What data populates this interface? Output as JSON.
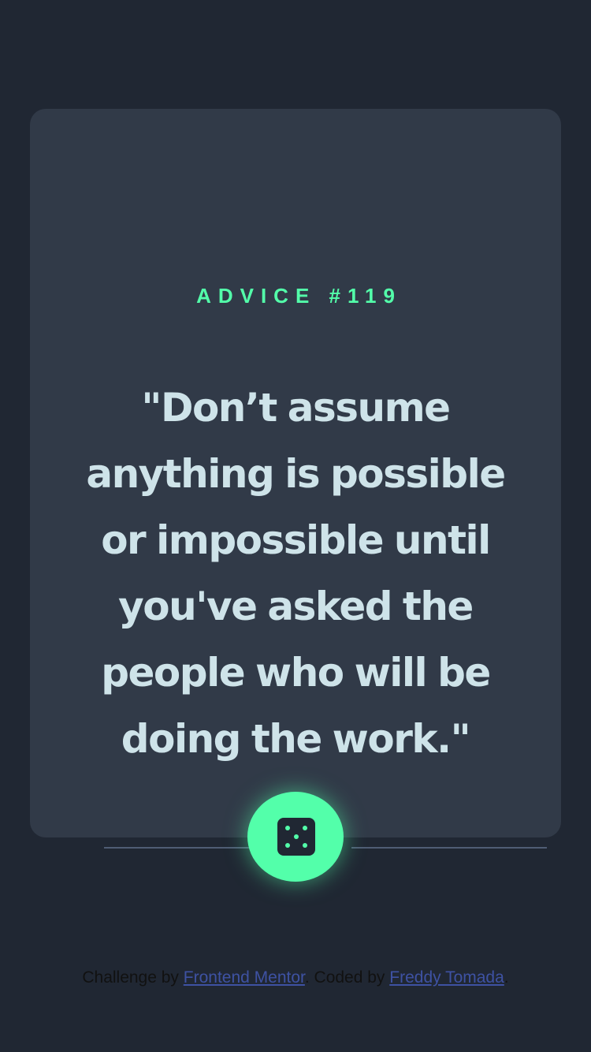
{
  "advice": {
    "id_label": "ADVICE #119",
    "quote": "\"Don’t assume anything is possible or impossible until you've asked the people who will be doing the work.\""
  },
  "divider": {
    "icon": "pause-icon"
  },
  "action": {
    "icon": "dice-icon"
  },
  "footer": {
    "prefix": "Challenge by ",
    "link1": "Frontend Mentor",
    "middle": ". Coded by ",
    "link2": "Freddy Tomada",
    "suffix": "."
  },
  "colors": {
    "background": "#202733",
    "card": "#313a48",
    "accent": "#53ffaa",
    "text": "#cee3e9",
    "divider": "#4f5d74",
    "link": "#3e52a3"
  }
}
